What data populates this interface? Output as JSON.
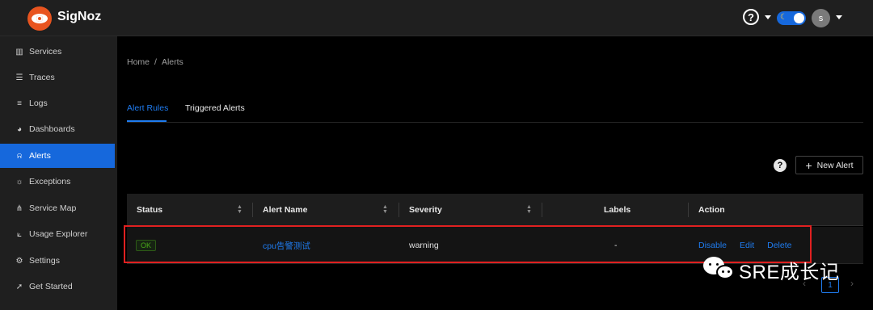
{
  "app": {
    "name": "SigNoz",
    "help_symbol": "?",
    "theme_icon": "moon-icon",
    "user_initial": "s"
  },
  "sidebar": {
    "items": [
      {
        "label": "Services",
        "icon": "bar-chart-icon",
        "active": false
      },
      {
        "label": "Traces",
        "icon": "menu-lines-icon",
        "active": false
      },
      {
        "label": "Logs",
        "icon": "list-icon",
        "active": false
      },
      {
        "label": "Dashboards",
        "icon": "dashboard-icon",
        "active": false
      },
      {
        "label": "Alerts",
        "icon": "alarm-icon",
        "active": true
      },
      {
        "label": "Exceptions",
        "icon": "bug-icon",
        "active": false
      },
      {
        "label": "Service Map",
        "icon": "map-nodes-icon",
        "active": false
      },
      {
        "label": "Usage Explorer",
        "icon": "line-chart-icon",
        "active": false
      },
      {
        "label": "Settings",
        "icon": "gear-icon",
        "active": false
      },
      {
        "label": "Get Started",
        "icon": "rocket-icon",
        "active": false
      }
    ]
  },
  "breadcrumb": {
    "home": "Home",
    "separator": "/",
    "current": "Alerts"
  },
  "tabs": [
    {
      "label": "Alert Rules",
      "active": true
    },
    {
      "label": "Triggered Alerts",
      "active": false
    }
  ],
  "toolbar": {
    "help_symbol": "?",
    "new_alert_label": "New Alert",
    "plus_symbol": "+"
  },
  "table": {
    "columns": [
      "Status",
      "Alert Name",
      "Severity",
      "Labels",
      "Action"
    ],
    "rows": [
      {
        "status": "OK",
        "alert_name": "cpu告警测试",
        "severity": "warning",
        "labels": "-",
        "actions": [
          "Disable",
          "Edit",
          "Delete"
        ]
      }
    ]
  },
  "pagination": {
    "prev": "‹",
    "current": "1",
    "next": "›"
  },
  "watermark": {
    "text": "SRE成长记"
  },
  "colors": {
    "accent": "#1668dc",
    "link": "#1f7cf0",
    "ok_green": "#49aa19",
    "highlight_red": "#e02020",
    "brand_orange": "#e8541f"
  }
}
